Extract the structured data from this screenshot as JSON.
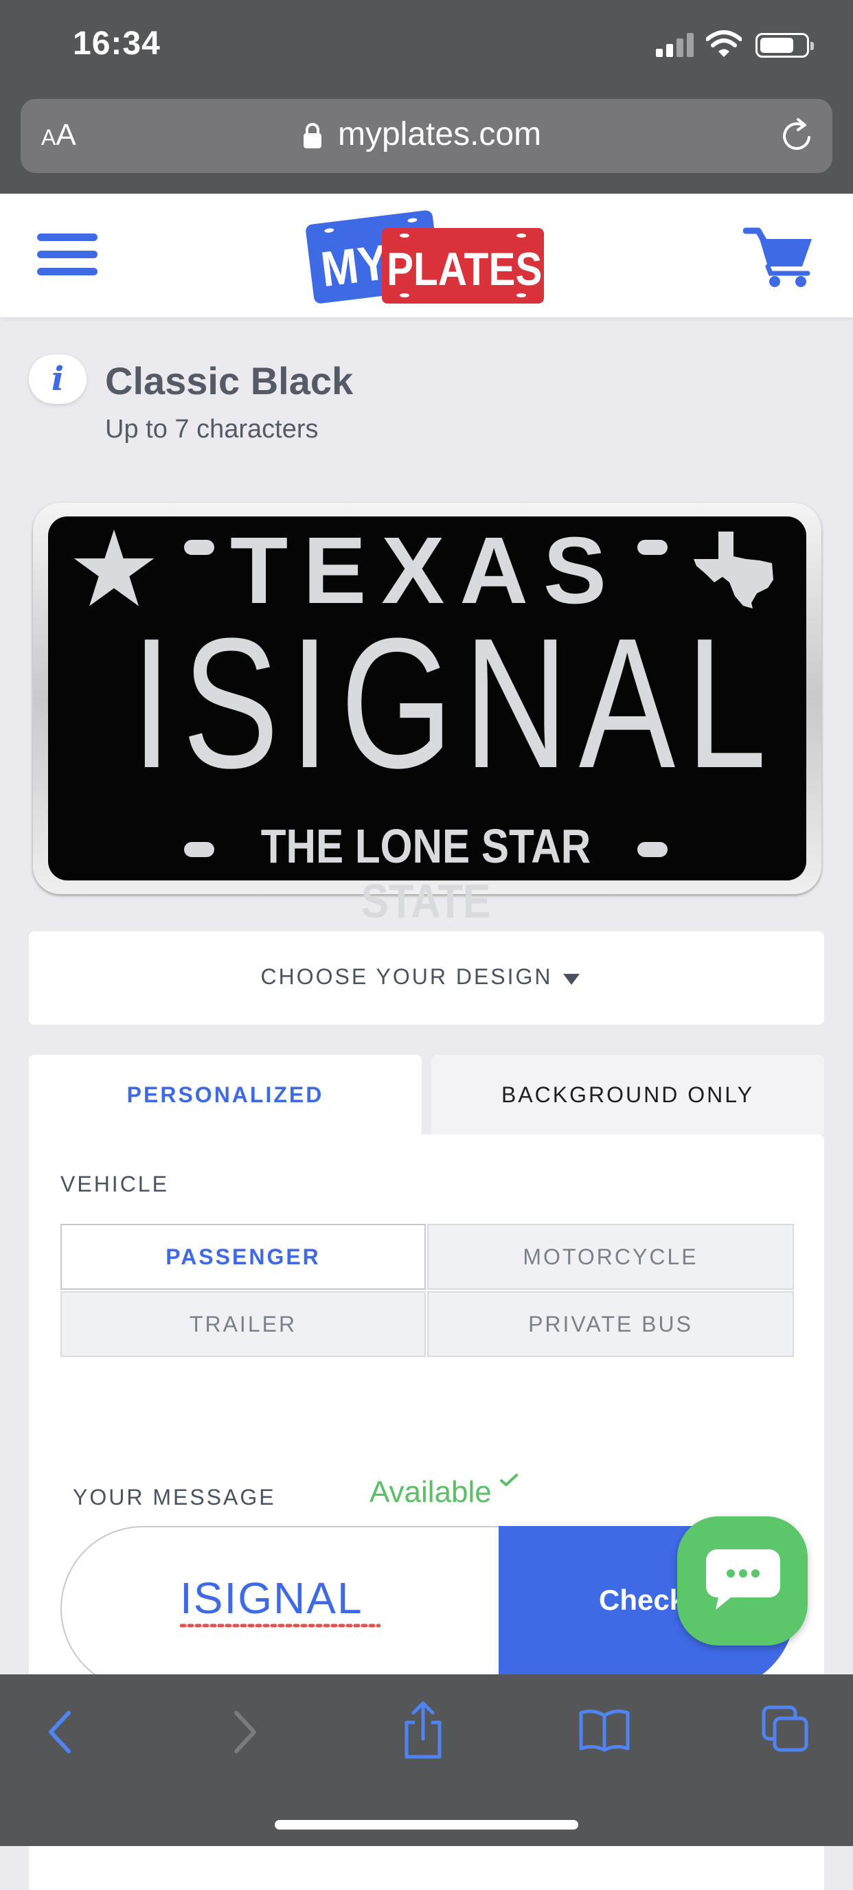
{
  "status_bar": {
    "time": "16:34"
  },
  "browser": {
    "text_size_label_small": "A",
    "text_size_label_large": "A",
    "url": "myplates.com"
  },
  "site": {
    "logo_left": "MY",
    "logo_right": "PLATES"
  },
  "plate_info": {
    "name": "Classic Black",
    "subtitle": "Up to 7 characters"
  },
  "plate": {
    "state": "TEXAS",
    "number": "ISIGNAL",
    "slogan": "THE LONE STAR STATE"
  },
  "design": {
    "label": "CHOOSE YOUR DESIGN"
  },
  "tabs": {
    "personalized": "PERSONALIZED",
    "background_only": "BACKGROUND ONLY",
    "active": "personalized"
  },
  "vehicle": {
    "label": "VEHICLE",
    "options": [
      "PASSENGER",
      "MOTORCYCLE",
      "TRAILER",
      "PRIVATE BUS"
    ],
    "selected": "PASSENGER"
  },
  "message": {
    "label": "YOUR MESSAGE",
    "status": "Available",
    "value": "ISIGNAL",
    "button": "Check"
  },
  "colors": {
    "brand_blue": "#3f6ae6",
    "brand_red": "#d9323a",
    "available_green": "#5cbf67",
    "chat_green": "#5cc66b"
  },
  "icons": [
    "back-icon",
    "forward-icon",
    "share-icon",
    "bookmarks-icon",
    "tabs-icon",
    "cart-icon",
    "menu-icon",
    "info-icon",
    "chat-icon",
    "lock-icon",
    "reload-icon"
  ]
}
